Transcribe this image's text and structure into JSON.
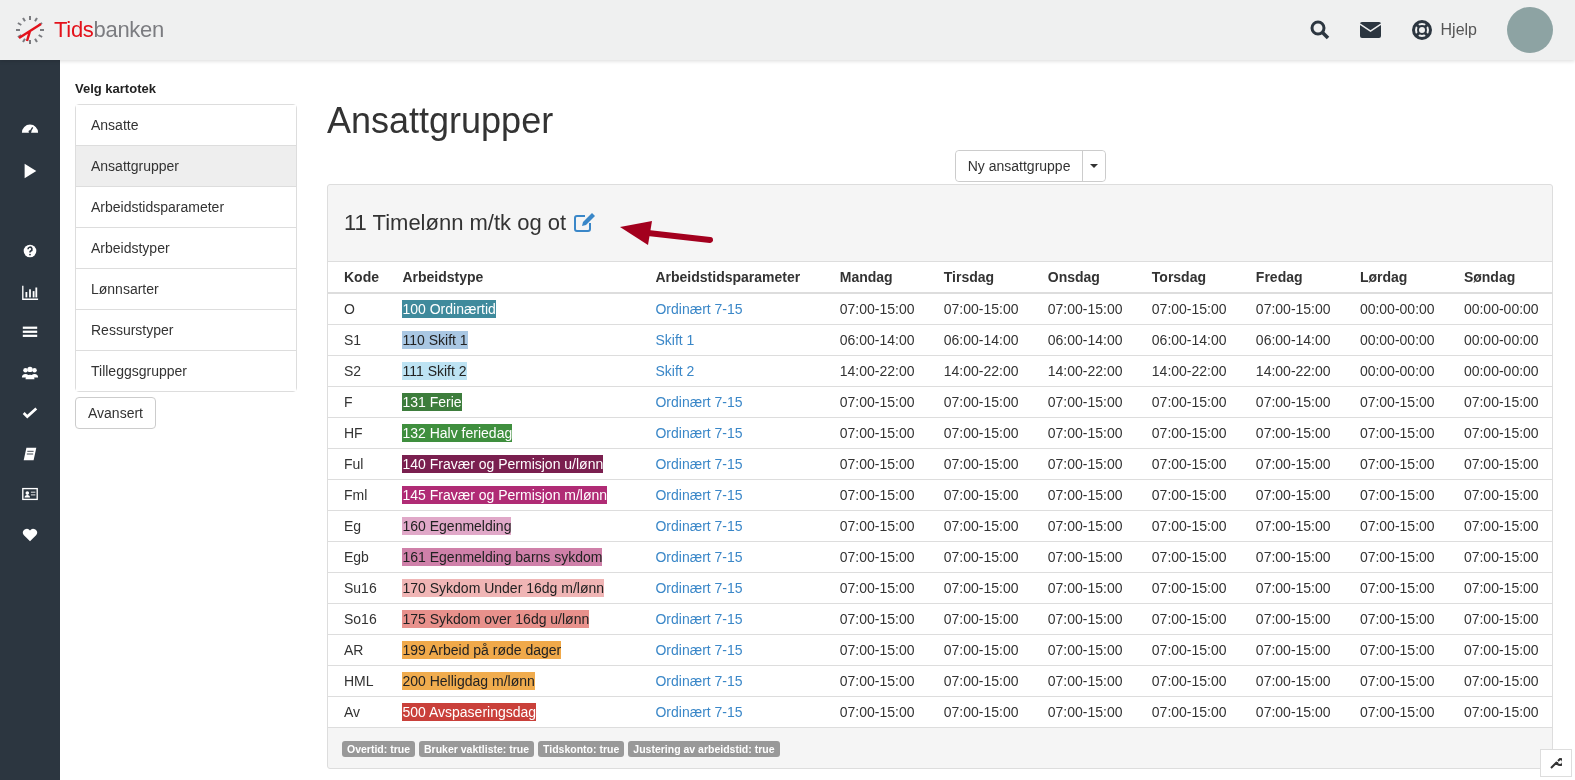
{
  "header": {
    "logo": {
      "accent": "Tids",
      "rest": "banken"
    },
    "help_label": "Hjelp"
  },
  "kartotek": {
    "title": "Velg kartotek",
    "items": [
      {
        "label": "Ansatte",
        "selected": false
      },
      {
        "label": "Ansattgrupper",
        "selected": true
      },
      {
        "label": "Arbeidstidsparameter",
        "selected": false
      },
      {
        "label": "Arbeidstyper",
        "selected": false
      },
      {
        "label": "Lønnsarter",
        "selected": false
      },
      {
        "label": "Ressurstyper",
        "selected": false
      },
      {
        "label": "Tilleggsgrupper",
        "selected": false
      }
    ],
    "advanced_button": "Avansert"
  },
  "page_title": "Ansattgrupper",
  "new_button": "Ny ansattgruppe",
  "group": {
    "title": "11 Timelønn m/tk og ot",
    "table": {
      "columns": [
        "Kode",
        "Arbeidstype",
        "Arbeidstidsparameter",
        "Mandag",
        "Tirsdag",
        "Onsdag",
        "Torsdag",
        "Fredag",
        "Lørdag",
        "Søndag"
      ],
      "rows": [
        {
          "code": "O",
          "work_type": "100 Ordinærtid",
          "color": "#3f8a9c",
          "parameter": "Ordinært 7-15",
          "days": [
            "07:00-15:00",
            "07:00-15:00",
            "07:00-15:00",
            "07:00-15:00",
            "07:00-15:00",
            "00:00-00:00",
            "00:00-00:00"
          ]
        },
        {
          "code": "S1",
          "work_type": "110 Skift 1",
          "color": "#a9c7e3",
          "parameter": "Skift 1",
          "days": [
            "06:00-14:00",
            "06:00-14:00",
            "06:00-14:00",
            "06:00-14:00",
            "06:00-14:00",
            "00:00-00:00",
            "00:00-00:00"
          ]
        },
        {
          "code": "S2",
          "work_type": "111 Skift 2",
          "color": "#bde3f3",
          "parameter": "Skift 2",
          "days": [
            "14:00-22:00",
            "14:00-22:00",
            "14:00-22:00",
            "14:00-22:00",
            "14:00-22:00",
            "00:00-00:00",
            "00:00-00:00"
          ]
        },
        {
          "code": "F",
          "work_type": "131 Ferie",
          "color": "#3d7d3c",
          "parameter": "Ordinært 7-15",
          "days": [
            "07:00-15:00",
            "07:00-15:00",
            "07:00-15:00",
            "07:00-15:00",
            "07:00-15:00",
            "07:00-15:00",
            "07:00-15:00"
          ]
        },
        {
          "code": "HF",
          "work_type": "132 Halv feriedag",
          "color": "#3f8f3e",
          "parameter": "Ordinært 7-15",
          "days": [
            "07:00-15:00",
            "07:00-15:00",
            "07:00-15:00",
            "07:00-15:00",
            "07:00-15:00",
            "07:00-15:00",
            "07:00-15:00"
          ]
        },
        {
          "code": "Ful",
          "work_type": "140 Fravær og Permisjon u/lønn",
          "color": "#7a1f4f",
          "parameter": "Ordinært 7-15",
          "days": [
            "07:00-15:00",
            "07:00-15:00",
            "07:00-15:00",
            "07:00-15:00",
            "07:00-15:00",
            "07:00-15:00",
            "07:00-15:00"
          ]
        },
        {
          "code": "Fml",
          "work_type": "145 Fravær og Permisjon m/lønn",
          "color": "#b02b75",
          "parameter": "Ordinært 7-15",
          "days": [
            "07:00-15:00",
            "07:00-15:00",
            "07:00-15:00",
            "07:00-15:00",
            "07:00-15:00",
            "07:00-15:00",
            "07:00-15:00"
          ]
        },
        {
          "code": "Eg",
          "work_type": "160 Egenmelding",
          "color": "#e0a8c8",
          "parameter": "Ordinært 7-15",
          "days": [
            "07:00-15:00",
            "07:00-15:00",
            "07:00-15:00",
            "07:00-15:00",
            "07:00-15:00",
            "07:00-15:00",
            "07:00-15:00"
          ]
        },
        {
          "code": "Egb",
          "work_type": "161 Egenmelding barns sykdom",
          "color": "#cf80a9",
          "parameter": "Ordinært 7-15",
          "days": [
            "07:00-15:00",
            "07:00-15:00",
            "07:00-15:00",
            "07:00-15:00",
            "07:00-15:00",
            "07:00-15:00",
            "07:00-15:00"
          ]
        },
        {
          "code": "Su16",
          "work_type": "170 Sykdom Under 16dg m/lønn",
          "color": "#f0b5b5",
          "parameter": "Ordinært 7-15",
          "days": [
            "07:00-15:00",
            "07:00-15:00",
            "07:00-15:00",
            "07:00-15:00",
            "07:00-15:00",
            "07:00-15:00",
            "07:00-15:00"
          ]
        },
        {
          "code": "So16",
          "work_type": "175 Sykdom over 16dg u/lønn",
          "color": "#e8918c",
          "parameter": "Ordinært 7-15",
          "days": [
            "07:00-15:00",
            "07:00-15:00",
            "07:00-15:00",
            "07:00-15:00",
            "07:00-15:00",
            "07:00-15:00",
            "07:00-15:00"
          ]
        },
        {
          "code": "AR",
          "work_type": "199 Arbeid på røde dager",
          "color": "#f0a94a",
          "parameter": "Ordinært 7-15",
          "days": [
            "07:00-15:00",
            "07:00-15:00",
            "07:00-15:00",
            "07:00-15:00",
            "07:00-15:00",
            "07:00-15:00",
            "07:00-15:00"
          ]
        },
        {
          "code": "HML",
          "work_type": "200 Helligdag m/lønn",
          "color": "#f0ac4e",
          "parameter": "Ordinært 7-15",
          "days": [
            "07:00-15:00",
            "07:00-15:00",
            "07:00-15:00",
            "07:00-15:00",
            "07:00-15:00",
            "07:00-15:00",
            "07:00-15:00"
          ]
        },
        {
          "code": "Av",
          "work_type": "500 Avspaseringsdag",
          "color": "#c9403a",
          "parameter": "Ordinært 7-15",
          "days": [
            "07:00-15:00",
            "07:00-15:00",
            "07:00-15:00",
            "07:00-15:00",
            "07:00-15:00",
            "07:00-15:00",
            "07:00-15:00"
          ]
        }
      ]
    },
    "tags": [
      "Overtid: true",
      "Bruker vaktliste: true",
      "Tidskonto: true",
      "Justering av arbeidstid: true"
    ]
  }
}
